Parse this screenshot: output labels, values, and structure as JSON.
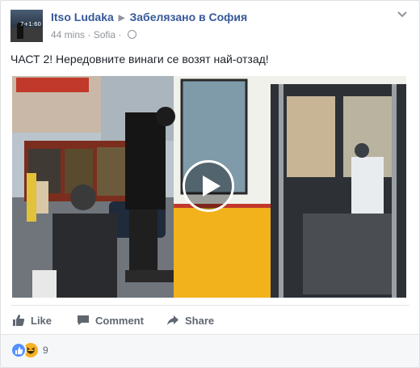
{
  "header": {
    "author": "Itso Ludaka",
    "location": "Забелязано в София",
    "time": "44 mins",
    "place": "Sofia",
    "separator": "·",
    "avatar_overlay": "7+1:60"
  },
  "post": {
    "text": "ЧАСТ 2! Нередовните винаги се возят най-отзад!"
  },
  "video": {
    "play_icon": "play-icon"
  },
  "actions": {
    "like_label": "Like",
    "comment_label": "Comment",
    "share_label": "Share"
  },
  "reactions": {
    "count": "9",
    "types": [
      "like",
      "haha"
    ]
  },
  "colors": {
    "link": "#365899",
    "meta": "#90949c",
    "action": "#606770",
    "tram_yellow": "#f2b21b"
  }
}
